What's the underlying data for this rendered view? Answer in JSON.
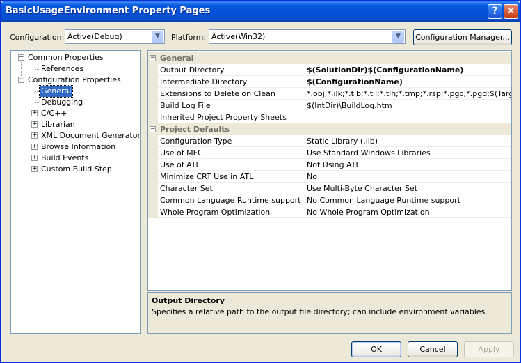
{
  "window": {
    "title": "BasicUsageEnvironment Property Pages",
    "help_label": "?",
    "close_label": "✕"
  },
  "config": {
    "configuration_label": "Configuration:",
    "configuration_value": "Active(Debug)",
    "platform_label": "Platform:",
    "platform_value": "Active(Win32)",
    "manager_label": "Configuration Manager..."
  },
  "tree": {
    "common_properties": "Common Properties",
    "references": "References",
    "configuration_properties": "Configuration Properties",
    "general": "General",
    "debugging": "Debugging",
    "c_cpp": "C/C++",
    "librarian": "Librarian",
    "xml_doc_gen": "XML Document Generator",
    "browse_information": "Browse Information",
    "build_events": "Build Events",
    "custom_build_step": "Custom Build Step"
  },
  "grid": {
    "general_category": "General",
    "general_rows": [
      {
        "name": "Output Directory",
        "value": "$(SolutionDir)$(ConfigurationName)"
      },
      {
        "name": "Intermediate Directory",
        "value": "$(ConfigurationName)"
      },
      {
        "name": "Extensions to Delete on Clean",
        "value": "*.obj;*.ilk;*.tlb;*.tli;*.tlh;*.tmp;*.rsp;*.pgc;*.pgd;$(TargetPath)"
      },
      {
        "name": "Build Log File",
        "value": "$(IntDir)\\BuildLog.htm"
      },
      {
        "name": "Inherited Project Property Sheets",
        "value": ""
      }
    ],
    "defaults_category": "Project Defaults",
    "defaults_rows": [
      {
        "name": "Configuration Type",
        "value": "Static Library (.lib)"
      },
      {
        "name": "Use of MFC",
        "value": "Use Standard Windows Libraries"
      },
      {
        "name": "Use of ATL",
        "value": "Not Using ATL"
      },
      {
        "name": "Minimize CRT Use in ATL",
        "value": "No"
      },
      {
        "name": "Character Set",
        "value": "Use Multi-Byte Character Set"
      },
      {
        "name": "Common Language Runtime support",
        "value": "No Common Language Runtime support"
      },
      {
        "name": "Whole Program Optimization",
        "value": "No Whole Program Optimization"
      }
    ]
  },
  "description": {
    "title": "Output Directory",
    "text": "Specifies a relative path to the output file directory; can include environment variables."
  },
  "buttons": {
    "ok": "OK",
    "cancel": "Cancel",
    "apply": "Apply"
  }
}
